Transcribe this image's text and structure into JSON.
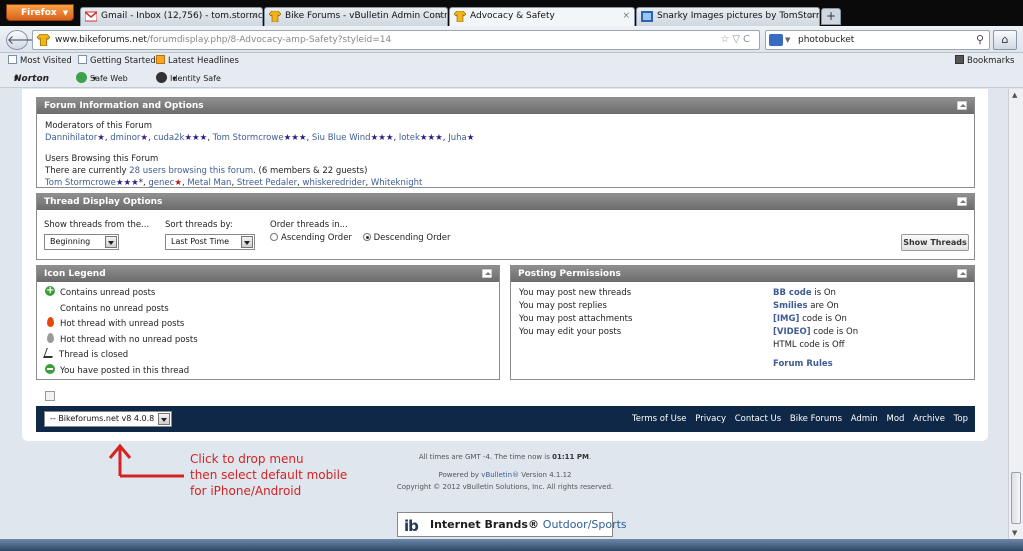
{
  "browser": {
    "firefox_label": "Firefox",
    "tabs": [
      {
        "title": "Gmail - Inbox (12,756) - tom.stormcr..."
      },
      {
        "title": "Bike Forums - vBulletin Admin Contr..."
      },
      {
        "title": "Advocacy & Safety"
      },
      {
        "title": "Snarky Images pictures by TomStorm..."
      }
    ],
    "url_domain": "www.bikeforums.net",
    "url_path": "/forumdisplay.php/8-Advocacy-amp-Safety?styleid=14",
    "search_value": "photobucket",
    "bookmarks": [
      "Most Visited",
      "Getting Started",
      "Latest Headlines"
    ],
    "bookmarks_right": "Bookmarks",
    "norton": {
      "logo": "Norton",
      "safe_web": "Safe Web",
      "identity_safe": "Identity Safe"
    }
  },
  "forum_info": {
    "header": "Forum Information and Options",
    "moderators_heading": "Moderators of this Forum",
    "moderators": [
      {
        "name": "Dannihilator",
        "stars": "★"
      },
      {
        "name": "dminor",
        "stars": "★"
      },
      {
        "name": "cuda2k",
        "stars": "★★★"
      },
      {
        "name": "Tom Stormcrowe",
        "stars": "★★★"
      },
      {
        "name": "Siu Blue Wind",
        "stars": "★★★"
      },
      {
        "name": "lotek",
        "stars": "★★★"
      },
      {
        "name": "Juha",
        "stars": "★"
      }
    ],
    "users_heading": "Users Browsing this Forum",
    "users_prefix": "There are currently",
    "users_link": "28 users browsing this forum",
    "users_suffix": ". (6 members & 22 guests)",
    "users": [
      {
        "name": "Tom Stormcrowe",
        "stars": "★★★",
        "extra": "*"
      },
      {
        "name": "genec",
        "stars": "★",
        "red": true
      },
      {
        "name": "Metal Man",
        "stars": ""
      },
      {
        "name": "Street Pedaler",
        "stars": ""
      },
      {
        "name": "whiskeredrider",
        "stars": ""
      },
      {
        "name": "Whiteknight",
        "stars": ""
      }
    ]
  },
  "thread_display": {
    "header": "Thread Display Options",
    "show_from_label": "Show threads from the...",
    "show_from_value": "Beginning",
    "sort_label": "Sort threads by:",
    "sort_value": "Last Post Time",
    "order_label": "Order threads in...",
    "ascending": "Ascending Order",
    "descending": "Descending Order",
    "show_button": "Show Threads"
  },
  "icon_legend": {
    "header": "Icon Legend",
    "items": [
      {
        "icon": "plus-icon",
        "label": "Contains unread posts"
      },
      {
        "icon": "page-icon",
        "label": "Contains no unread posts"
      },
      {
        "icon": "hot-flame-icon",
        "label": "Hot thread with unread posts"
      },
      {
        "icon": "grey-flame-icon",
        "label": "Hot thread with no unread posts"
      },
      {
        "icon": "lock-icon",
        "label": "Thread is closed"
      },
      {
        "icon": "posted-icon",
        "label": "You have posted in this thread"
      }
    ]
  },
  "permissions": {
    "header": "Posting Permissions",
    "rows": [
      {
        "left": "You may post new threads",
        "bold": "BB code",
        "rest": " is On"
      },
      {
        "left": "You may post replies",
        "bold": "Smilies",
        "rest": " are On"
      },
      {
        "left": "You may post attachments",
        "bold": "[IMG]",
        "rest": " code is On"
      },
      {
        "left": "You may edit your posts",
        "bold": "[VIDEO]",
        "rest": " code is On"
      },
      {
        "left": "",
        "bold": "",
        "rest": "HTML code is Off"
      }
    ],
    "rules_link": "Forum Rules"
  },
  "footer": {
    "style_select": "-- Bikeforums.net v8 4.0.8",
    "links": [
      "Terms of Use",
      "Privacy",
      "Contact Us",
      "Bike Forums",
      "Admin",
      "Mod",
      "Archive",
      "Top"
    ]
  },
  "annotation": {
    "line1": "Click to drop menu",
    "line2": "then select default mobile",
    "line3": "for iPhone/Android"
  },
  "copyright": {
    "time_prefix": "All times are GMT -4. The time now is ",
    "time": "01:11 PM",
    "time_suffix": ".",
    "powered_prefix": "Powered by ",
    "powered_link": "vBulletin®",
    "powered_suffix": " Version 4.1.12",
    "copy": "Copyright © 2012 vBulletin Solutions, Inc. All rights reserved."
  },
  "sponsor": {
    "mark": "ib",
    "name": "Internet Brands",
    "category": "Outdoor/Sports"
  }
}
